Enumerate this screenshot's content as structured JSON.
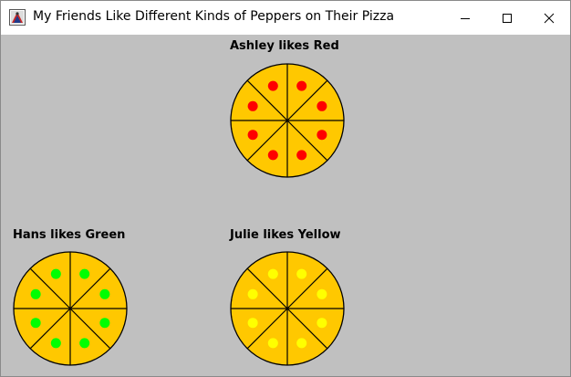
{
  "window": {
    "title": "My Friends Like Different Kinds of Peppers on Their Pizza",
    "controls": [
      "minimize-icon",
      "maximize-icon",
      "close-icon"
    ]
  },
  "friends": [
    {
      "label": "Ashley likes Red",
      "pepper_color": "#ff0000"
    },
    {
      "label": "Hans likes Green",
      "pepper_color": "#00ff00"
    },
    {
      "label": "Julie likes Yellow",
      "pepper_color": "#ffff00"
    }
  ],
  "pizza": {
    "slices": 8,
    "peppers_per_pizza": 8,
    "crust_color": "#ffc800",
    "line_color": "#000000"
  },
  "colors": {
    "background": "#c0c0c0",
    "titlebar": "#ffffff"
  }
}
